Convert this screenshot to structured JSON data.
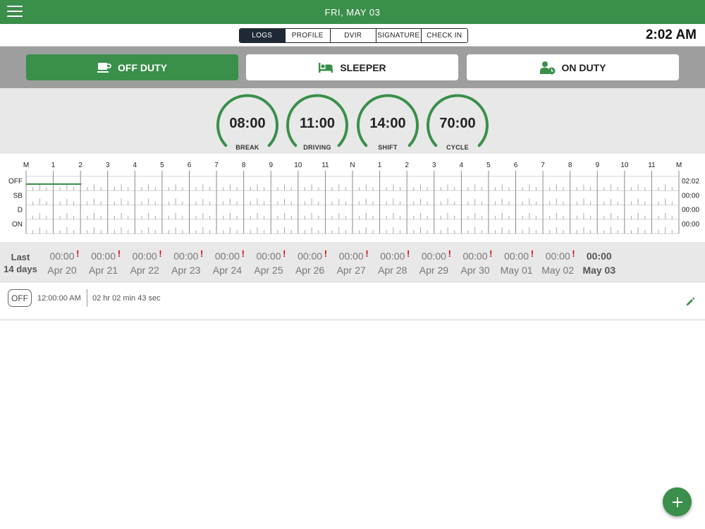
{
  "header": {
    "date": "FRI, MAY  03"
  },
  "tabs": [
    "LOGS",
    "PROFILE",
    "DVIR",
    "SIGNATURE",
    "CHECK IN"
  ],
  "clock": "2:02 AM",
  "status_buttons": {
    "off_duty": "OFF DUTY",
    "sleeper": "SLEEPER",
    "on_duty": "ON DUTY"
  },
  "gauges": [
    {
      "value": "08:00",
      "label": "BREAK"
    },
    {
      "value": "11:00",
      "label": "DRIVING"
    },
    {
      "value": "14:00",
      "label": "SHIFT"
    },
    {
      "value": "70:00",
      "label": "CYCLE"
    }
  ],
  "graph": {
    "hour_labels": [
      "M",
      "1",
      "2",
      "3",
      "4",
      "5",
      "6",
      "7",
      "8",
      "9",
      "10",
      "11",
      "N",
      "1",
      "2",
      "3",
      "4",
      "5",
      "6",
      "7",
      "8",
      "9",
      "10",
      "11",
      "M"
    ],
    "rows": [
      "OFF",
      "SB",
      "D",
      "ON"
    ],
    "totals": [
      "02:02",
      "00:00",
      "00:00",
      "00:00"
    ],
    "off_duty_until_hour": 2.033
  },
  "history": {
    "label_line1": "Last",
    "label_line2": "14 days",
    "days": [
      {
        "time": "00:00",
        "date": "Apr 20"
      },
      {
        "time": "00:00",
        "date": "Apr 21"
      },
      {
        "time": "00:00",
        "date": "Apr 22"
      },
      {
        "time": "00:00",
        "date": "Apr 23"
      },
      {
        "time": "00:00",
        "date": "Apr 24"
      },
      {
        "time": "00:00",
        "date": "Apr 25"
      },
      {
        "time": "00:00",
        "date": "Apr 26"
      },
      {
        "time": "00:00",
        "date": "Apr 27"
      },
      {
        "time": "00:00",
        "date": "Apr 28"
      },
      {
        "time": "00:00",
        "date": "Apr 29"
      },
      {
        "time": "00:00",
        "date": "Apr 30"
      },
      {
        "time": "00:00",
        "date": "May 01"
      },
      {
        "time": "00:00",
        "date": "May 02"
      }
    ],
    "current": {
      "time": "00:00",
      "date": "May 03"
    },
    "warning_mark": "!"
  },
  "log_entry": {
    "status": "OFF",
    "start_time": "12:00:00 AM",
    "duration": "02 hr 02 min 43 sec"
  },
  "colors": {
    "accent": "#3a8f4a",
    "warning": "#d01010",
    "active_tab": "#1f2a36"
  },
  "icons": {
    "menu": "hamburger-menu-icon",
    "theme": "moon-icon",
    "off_duty": "coffee-cup-icon",
    "sleeper": "bed-icon",
    "on_duty": "person-clock-icon",
    "edit": "pencil-icon",
    "add": "plus-icon"
  }
}
